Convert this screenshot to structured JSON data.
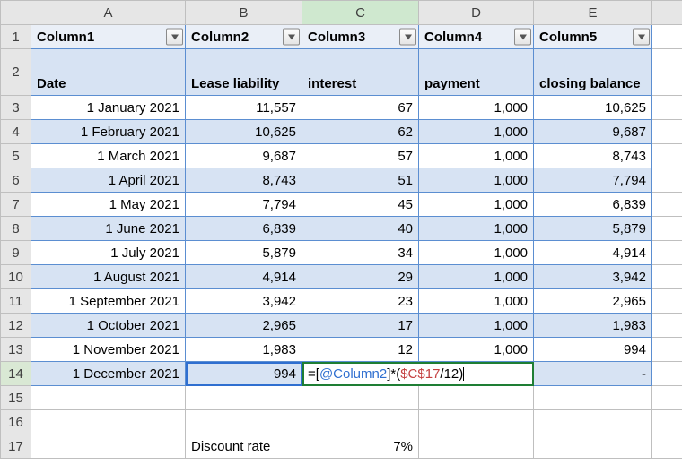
{
  "columns": [
    "A",
    "B",
    "C",
    "D",
    "E"
  ],
  "headerRow1": {
    "A": "Column1",
    "B": "Column2",
    "C": "Column3",
    "D": "Column4",
    "E": "Column5"
  },
  "headerRow2": {
    "A": "Date",
    "B": "Lease liability",
    "C": "interest",
    "D": "payment",
    "E": "closing balance"
  },
  "rows": [
    {
      "n": 3,
      "date": "1 January 2021",
      "lease": "11,557",
      "interest": "67",
      "payment": "1,000",
      "closing": "10,625"
    },
    {
      "n": 4,
      "date": "1 February 2021",
      "lease": "10,625",
      "interest": "62",
      "payment": "1,000",
      "closing": "9,687"
    },
    {
      "n": 5,
      "date": "1 March 2021",
      "lease": "9,687",
      "interest": "57",
      "payment": "1,000",
      "closing": "8,743"
    },
    {
      "n": 6,
      "date": "1 April 2021",
      "lease": "8,743",
      "interest": "51",
      "payment": "1,000",
      "closing": "7,794"
    },
    {
      "n": 7,
      "date": "1 May 2021",
      "lease": "7,794",
      "interest": "45",
      "payment": "1,000",
      "closing": "6,839"
    },
    {
      "n": 8,
      "date": "1 June 2021",
      "lease": "6,839",
      "interest": "40",
      "payment": "1,000",
      "closing": "5,879"
    },
    {
      "n": 9,
      "date": "1 July 2021",
      "lease": "5,879",
      "interest": "34",
      "payment": "1,000",
      "closing": "4,914"
    },
    {
      "n": 10,
      "date": "1 August 2021",
      "lease": "4,914",
      "interest": "29",
      "payment": "1,000",
      "closing": "3,942"
    },
    {
      "n": 11,
      "date": "1 September 2021",
      "lease": "3,942",
      "interest": "23",
      "payment": "1,000",
      "closing": "2,965"
    },
    {
      "n": 12,
      "date": "1 October 2021",
      "lease": "2,965",
      "interest": "17",
      "payment": "1,000",
      "closing": "1,983"
    },
    {
      "n": 13,
      "date": "1 November 2021",
      "lease": "1,983",
      "interest": "12",
      "payment": "1,000",
      "closing": "994"
    },
    {
      "n": 14,
      "date": "1 December 2021",
      "lease": "994",
      "interest": "",
      "payment": "",
      "closing": "-"
    }
  ],
  "formula": {
    "part1": "=[",
    "ref1": "@Column2",
    "part2": "]*(",
    "ref2": "$C$17",
    "part3": "/12)"
  },
  "discount": {
    "label": "Discount rate",
    "value": "7%",
    "row": 17
  },
  "rowNumbers": [
    1,
    2,
    3,
    4,
    5,
    6,
    7,
    8,
    9,
    10,
    11,
    12,
    13,
    14,
    15,
    16,
    17
  ],
  "activeCell": "C14",
  "refCellBlue": "B14",
  "refCellRed": "C17"
}
